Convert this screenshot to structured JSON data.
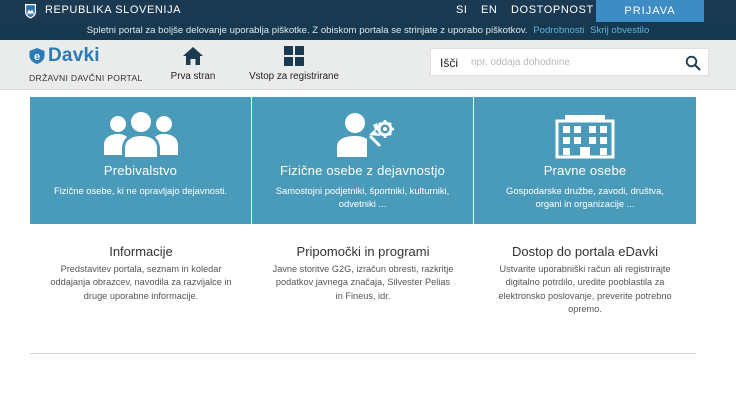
{
  "gov_bar": {
    "name": "REPUBLIKA SLOVENIJA",
    "lang_si": "SI",
    "lang_en": "EN",
    "accessibility": "DOSTOPNOST",
    "login": "PRIJAVA"
  },
  "cookie_bar": {
    "text": "Spletni portal za boljše delovanje uporablja piškotke. Z obiskom portala se strinjate z uporabo piškotkov.",
    "details_link": "Podrobnosti",
    "hide_link": "Skrij obvestilo"
  },
  "header": {
    "logo_text": "Davki",
    "portal_label": "DRŽAVNI DAVČNI PORTAL",
    "nav_home": "Prva stran",
    "nav_register": "Vstop za registrirane",
    "search_label": "Išči",
    "search_placeholder": "npr. oddaja dohodnine",
    "search_value": ""
  },
  "tiles": [
    {
      "title": "Prebivalstvo",
      "desc": "Fizične osebe, ki ne opravljajo dejavnosti.",
      "icon": "people-icon"
    },
    {
      "title": "Fizične osebe z dejavnostjo",
      "desc": "Samostojni podjetniki, športniki, kulturniki, odvetniki ...",
      "icon": "person-tools-icon"
    },
    {
      "title": "Pravne osebe",
      "desc": "Gospodarske družbe, zavodi, društva, organi in organizacije ...",
      "icon": "building-icon"
    }
  ],
  "info": [
    {
      "title": "Informacije",
      "desc": "Predstavitev portala, seznam in koledar oddajanja obrazcev, navodila za razvijalce in druge uporabne informacije."
    },
    {
      "title": "Pripomočki in programi",
      "desc": "Javne storitve G2G, izračun obresti, razkritje podatkov javnega značaja, Silvester Pelias in Fineus, idr."
    },
    {
      "title": "Dostop do portala eDavki",
      "desc": "Ustvarite uporabniški račun ali registrirajte digitalno potrdilo, uredite pooblastila za elektronsko poslovanje, preverite potrebno opremo."
    }
  ],
  "colors": {
    "gov_bar": "#1b3a52",
    "login": "#3d8cc4",
    "tile": "#4a9bb9",
    "logo": "#2a7bb3"
  }
}
